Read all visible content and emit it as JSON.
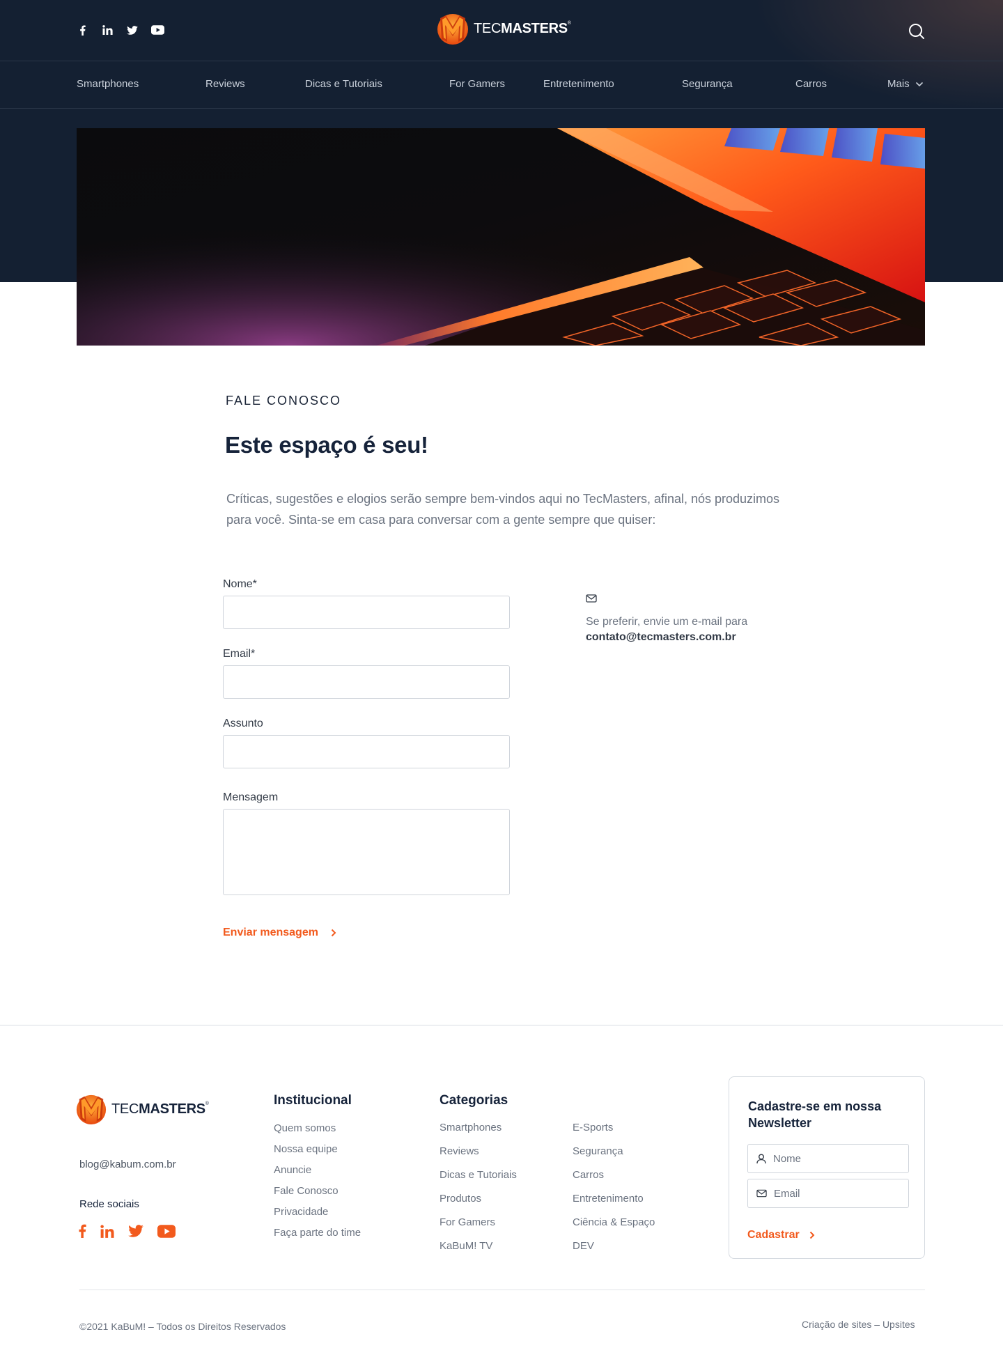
{
  "brand": {
    "logo_prefix": "TEC",
    "logo_bold": "MASTERS",
    "logo_mark": "®",
    "accent_color": "#f25a1d",
    "header_color": "#142032"
  },
  "header": {
    "social_icons": [
      "facebook-icon",
      "linkedin-icon",
      "twitter-icon",
      "youtube-icon"
    ],
    "search_icon": "search-icon"
  },
  "nav": {
    "items": [
      {
        "label": "Smartphones"
      },
      {
        "label": "Reviews"
      },
      {
        "label": "Dicas e Tutoriais"
      },
      {
        "label": "For Gamers"
      },
      {
        "label": "Entretenimento"
      },
      {
        "label": "Segurança"
      },
      {
        "label": "Carros"
      },
      {
        "label": "Mais"
      }
    ]
  },
  "contact": {
    "eyebrow": "FALE CONOSCO",
    "headline": "Este espaço é seu!",
    "intro": "Críticas, sugestões e elogios serão sempre bem-vindos aqui no TecMasters, afinal, nós produzimos para você. Sinta-se em casa para conversar com a gente sempre que quiser:",
    "fields": {
      "name_label": "Nome*",
      "email_label": "Email*",
      "subject_label": "Assunto",
      "message_label": "Mensagem"
    },
    "submit_label": "Enviar mensagem",
    "aside_text": "Se preferir, envie um e-mail para",
    "aside_email": "contato@tecmasters.com.br"
  },
  "footer": {
    "email": "blog@kabum.com.br",
    "social_title": "Rede sociais",
    "institutional": {
      "title": "Institucional",
      "links": [
        "Quem somos",
        "Nossa equipe",
        "Anuncie",
        "Fale Conosco",
        "Privacidade",
        "Faça parte do time"
      ]
    },
    "categories": {
      "title": "Categorias",
      "col1": [
        "Smartphones",
        "Reviews",
        "Dicas e Tutoriais",
        "Produtos",
        "For Gamers",
        "KaBuM! TV"
      ],
      "col2": [
        "E-Sports",
        "Segurança",
        "Carros",
        "Entretenimento",
        "Ciência & Espaço",
        "DEV"
      ]
    },
    "newsletter": {
      "title": "Cadastre-se em nossa Newsletter",
      "name_placeholder": "Nome",
      "email_placeholder": "Email",
      "submit_label": "Cadastrar"
    },
    "copyright": "©2021 KaBuM! – Todos os Direitos Reservados",
    "credit": "Criação de sites – Upsites"
  }
}
